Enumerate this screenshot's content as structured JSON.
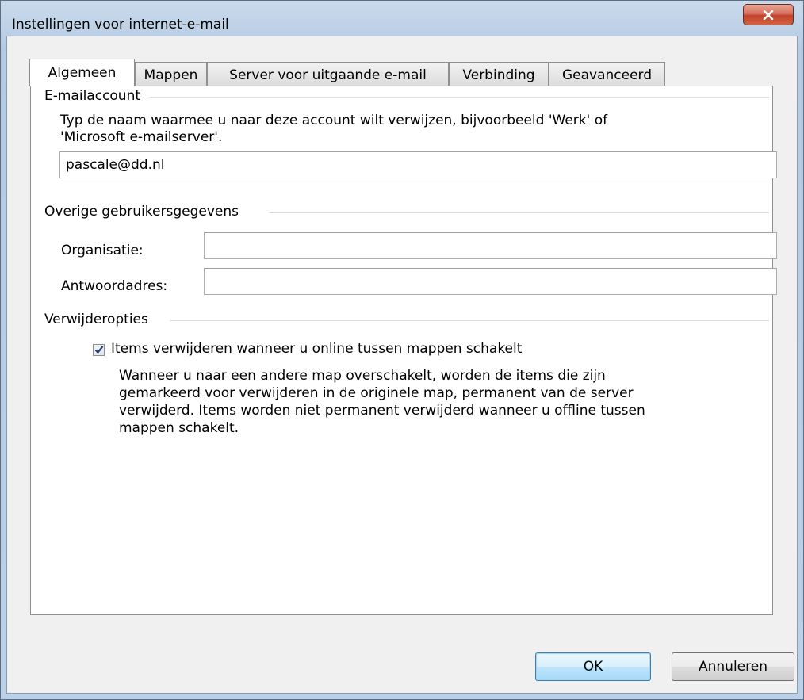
{
  "window": {
    "title": "Instellingen voor internet-e-mail",
    "close_label": "x"
  },
  "tabs": [
    {
      "label": "Algemeen",
      "active": true
    },
    {
      "label": "Mappen",
      "active": false
    },
    {
      "label": "Server voor uitgaande e-mail",
      "active": false
    },
    {
      "label": "Verbinding",
      "active": false
    },
    {
      "label": "Geavanceerd",
      "active": false
    }
  ],
  "email_account": {
    "group_label": "E-mailaccount",
    "description_line1": "Typ de naam waarmee u naar deze account wilt verwijzen, bijvoorbeeld 'Werk' of",
    "description_line2": "'Microsoft e-mailserver'.",
    "account_name_value": "pascale@dd.nl"
  },
  "user_info": {
    "group_label": "Overige gebruikersgegevens",
    "organization_label": "Organisatie:",
    "organization_value": "",
    "reply_address_label": "Antwoordadres:",
    "reply_address_value": ""
  },
  "delete_options": {
    "group_label": "Verwijderopties",
    "checkbox_label": "Items verwijderen wanneer u online tussen mappen schakelt",
    "checkbox_checked": true,
    "help_line1": "Wanneer u naar een andere map overschakelt, worden de items die zijn",
    "help_line2": "gemarkeerd voor verwijderen in de originele map, permanent van de server",
    "help_line3": "verwijderd. Items worden niet permanent verwijderd wanneer u offline tussen",
    "help_line4": "mappen schakelt."
  },
  "buttons": {
    "ok_label": "OK",
    "cancel_label": "Annuleren"
  },
  "colors": {
    "close_button": "#c7452f",
    "default_button_border": "#3c7fb1",
    "checkmark": "#1f3d7a"
  },
  "icons": {
    "close": "close-icon",
    "check": "checkmark-icon"
  }
}
